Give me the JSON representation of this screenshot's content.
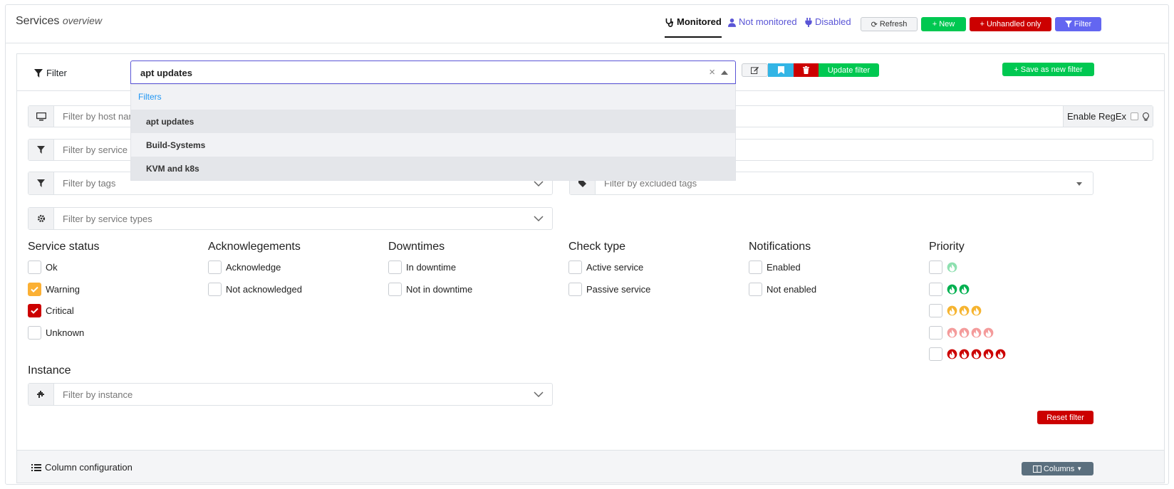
{
  "header": {
    "title": "Services",
    "subtitle": "overview",
    "tabs": [
      {
        "label": "Monitored",
        "icon": "stethoscope-icon",
        "active": true
      },
      {
        "label": "Not monitored",
        "icon": "user-md-icon",
        "active": false
      },
      {
        "label": "Disabled",
        "icon": "plug-icon",
        "active": false
      }
    ],
    "buttons": {
      "refresh": "Refresh",
      "new": "New",
      "unhandled": "Unhandled only",
      "filter": "Filter"
    }
  },
  "filter_bar": {
    "label": "Filter",
    "selected": "apt updates",
    "update_filter": "Update filter",
    "save_as_new": "Save as new filter",
    "dropdown": {
      "group": "Filters",
      "options": [
        "apt updates",
        "Build-Systems",
        "KVM and k8s"
      ]
    }
  },
  "inputs": {
    "host_placeholder": "Filter by host name",
    "regex_label": "Enable RegEx",
    "service_placeholder": "Filter by service name",
    "tags_placeholder": "Filter by tags",
    "excluded_tags_placeholder": "Filter by excluded tags",
    "service_types_placeholder": "Filter by service types",
    "instance_placeholder": "Filter by instance"
  },
  "sections": {
    "service_status": {
      "title": "Service status",
      "items": [
        {
          "label": "Ok",
          "checked": false
        },
        {
          "label": "Warning",
          "checked": true
        },
        {
          "label": "Critical",
          "checked": true
        },
        {
          "label": "Unknown",
          "checked": false
        }
      ]
    },
    "acknowledgements": {
      "title": "Acknowlegements",
      "items": [
        {
          "label": "Acknowledge"
        },
        {
          "label": "Not acknowledged"
        }
      ]
    },
    "downtimes": {
      "title": "Downtimes",
      "items": [
        {
          "label": "In downtime"
        },
        {
          "label": "Not in downtime"
        }
      ]
    },
    "check_type": {
      "title": "Check type",
      "items": [
        {
          "label": "Active service"
        },
        {
          "label": "Passive service"
        }
      ]
    },
    "notifications": {
      "title": "Notifications",
      "items": [
        {
          "label": "Enabled"
        },
        {
          "label": "Not enabled"
        }
      ]
    },
    "priority": {
      "title": "Priority",
      "levels": [
        {
          "count": 1,
          "color": "#8ee0b0"
        },
        {
          "count": 2,
          "color": "#00b050"
        },
        {
          "count": 3,
          "color": "#f6b430"
        },
        {
          "count": 4,
          "color": "#f49b9b"
        },
        {
          "count": 5,
          "color": "#cc0000"
        }
      ]
    },
    "instance": {
      "title": "Instance"
    }
  },
  "reset_filter": "Reset filter",
  "footer": {
    "column_config": "Column configuration",
    "columns_button": "Columns"
  }
}
